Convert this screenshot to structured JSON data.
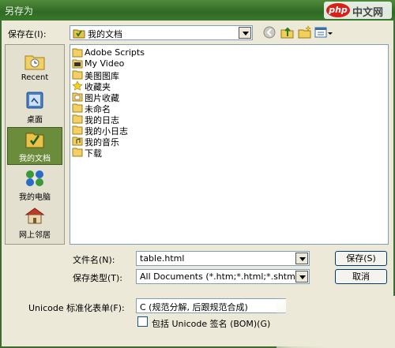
{
  "window": {
    "title": "另存为"
  },
  "watermark": {
    "logo": "php",
    "text": "中文网"
  },
  "save_in": {
    "label": "保存在(I):",
    "value": "我的文档"
  },
  "toolbar": {
    "icons": [
      "back-icon",
      "up-folder-icon",
      "new-folder-icon",
      "view-menu-icon"
    ]
  },
  "places": [
    {
      "label": "Recent",
      "icon": "recent-folder-icon"
    },
    {
      "label": "桌面",
      "icon": "desktop-icon"
    },
    {
      "label": "我的文档",
      "icon": "my-documents-icon",
      "selected": true
    },
    {
      "label": "我的电脑",
      "icon": "my-computer-icon"
    },
    {
      "label": "网上邻居",
      "icon": "network-icon"
    }
  ],
  "files": [
    {
      "name": "Adobe Scripts",
      "icon": "folder-icon"
    },
    {
      "name": "My Video",
      "icon": "video-folder-icon"
    },
    {
      "name": "美图图库",
      "icon": "folder-icon"
    },
    {
      "name": "收藏夹",
      "icon": "favorites-folder-icon"
    },
    {
      "name": "图片收藏",
      "icon": "pictures-folder-icon"
    },
    {
      "name": "未命名",
      "icon": "folder-icon"
    },
    {
      "name": "我的日志",
      "icon": "folder-icon"
    },
    {
      "name": "我的小日志",
      "icon": "folder-icon"
    },
    {
      "name": "我的音乐",
      "icon": "music-folder-icon"
    },
    {
      "name": "下载",
      "icon": "folder-icon"
    }
  ],
  "filename": {
    "label": "文件名(N):",
    "value": "table.html"
  },
  "filetype": {
    "label": "保存类型(T):",
    "value": "All Documents (*.htm;*.html;*.shtm;*."
  },
  "buttons": {
    "save": "保存(S)",
    "cancel": "取消"
  },
  "unicode": {
    "label": "Unicode 标准化表单(F):",
    "value": "C (规范分解, 后跟规范合成)"
  },
  "bom": {
    "label": "包括 Unicode 签名 (BOM)(G)",
    "checked": false
  },
  "colors": {
    "titlebar": "#2f6a25",
    "selected_place": "#6b8c3b",
    "dialog_bg": "#ece9d8"
  }
}
